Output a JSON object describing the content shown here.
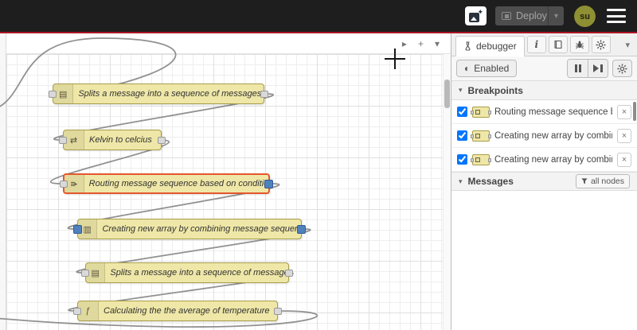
{
  "header": {
    "deploy_label": "Deploy",
    "deploy_caret": "▾",
    "avatar_initials": "su",
    "sparkle": "✦"
  },
  "workspace": {
    "tab_controls": {
      "scroll_right": "▸",
      "add": "+",
      "list": "▾"
    },
    "nodes": [
      {
        "label": "Splits a message into a sequence of messages.",
        "glyph": "▤"
      },
      {
        "label": "Kelvin to celcius",
        "glyph": "⇄"
      },
      {
        "label": "Routing message sequence based on condition",
        "glyph": "⋔"
      },
      {
        "label": "Creating new array by combining message sequence",
        "glyph": "▥"
      },
      {
        "label": "Splits a message into a sequence of messages.",
        "glyph": "▤"
      },
      {
        "label": "Calculating the the average of temperature",
        "glyph": "ƒ"
      }
    ]
  },
  "sidebar": {
    "tab_label": "debugger",
    "info_glyph": "i",
    "collapse_caret": "▾",
    "toolbar": {
      "toggle_glyph": "◐",
      "enabled_label": "Enabled"
    },
    "breakpoints": {
      "chevron": "▾",
      "title": "Breakpoints",
      "items": [
        {
          "checked": true,
          "label": "Routing message sequence based on condition",
          "close": "×"
        },
        {
          "checked": true,
          "label": "Creating new array by combining message sequence",
          "close": "×"
        },
        {
          "checked": true,
          "label": "Creating new array by combining message sequence",
          "close": "×"
        }
      ]
    },
    "messages": {
      "chevron": "▾",
      "title": "Messages",
      "filter_label": "all nodes"
    }
  },
  "colors": {
    "header_bg": "#1e1e1e",
    "accent_red": "#ad1625",
    "node_fill": "#efe7a7",
    "node_border": "#a89d4d",
    "selected_border": "#e4572e",
    "breakpoint_blue": "#4f81bd",
    "wire": "#919191"
  }
}
